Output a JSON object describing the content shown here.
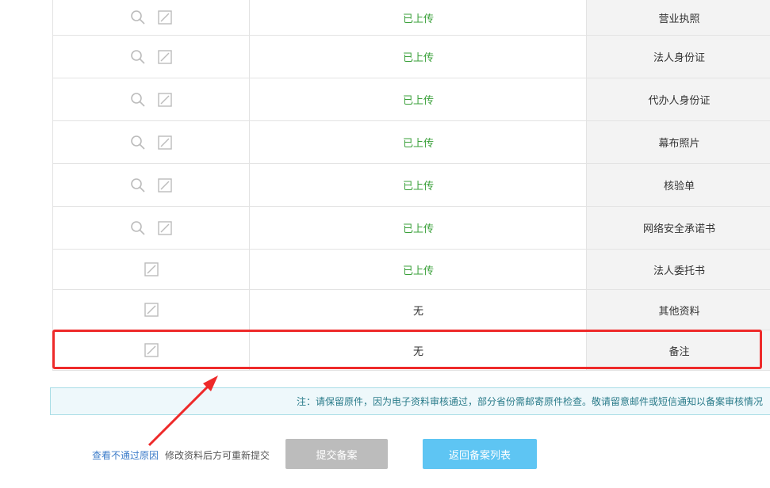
{
  "rows": [
    {
      "label": "营业执照",
      "status": "已上传",
      "status_type": "ok",
      "icons": [
        "search-icon",
        "edit-icon"
      ]
    },
    {
      "label": "法人身份证",
      "status": "已上传",
      "status_type": "ok",
      "icons": [
        "search-icon",
        "edit-icon"
      ]
    },
    {
      "label": "代办人身份证",
      "status": "已上传",
      "status_type": "ok",
      "icons": [
        "search-icon",
        "edit-icon"
      ]
    },
    {
      "label": "幕布照片",
      "status": "已上传",
      "status_type": "ok",
      "icons": [
        "search-icon",
        "edit-icon"
      ]
    },
    {
      "label": "核验单",
      "status": "已上传",
      "status_type": "ok",
      "icons": [
        "search-icon",
        "edit-icon"
      ]
    },
    {
      "label": "网络安全承诺书",
      "status": "已上传",
      "status_type": "ok",
      "icons": [
        "search-icon",
        "edit-icon"
      ]
    },
    {
      "label": "法人委托书",
      "status": "已上传",
      "status_type": "ok",
      "icons": [
        "edit-icon"
      ]
    },
    {
      "label": "其他资料",
      "status": "无",
      "status_type": "none",
      "icons": [
        "edit-icon"
      ]
    },
    {
      "label": "备注",
      "status": "无",
      "status_type": "none",
      "icons": [
        "edit-icon"
      ]
    }
  ],
  "notice": "注：请保留原件，因为电子资料审核通过，部分省份需邮寄原件检查。敬请留意邮件或短信通知以备案审核情况",
  "buttons": {
    "back": "返回备案列表",
    "submit": "提交备案"
  },
  "hint": "修改资料后方可重新提交",
  "link": "查看不通过原因",
  "colors": {
    "status_ok": "#3aa03a",
    "highlight": "#ee2a2a",
    "primary_button": "#5ec5f3",
    "disabled_button": "#bcbcbc"
  }
}
